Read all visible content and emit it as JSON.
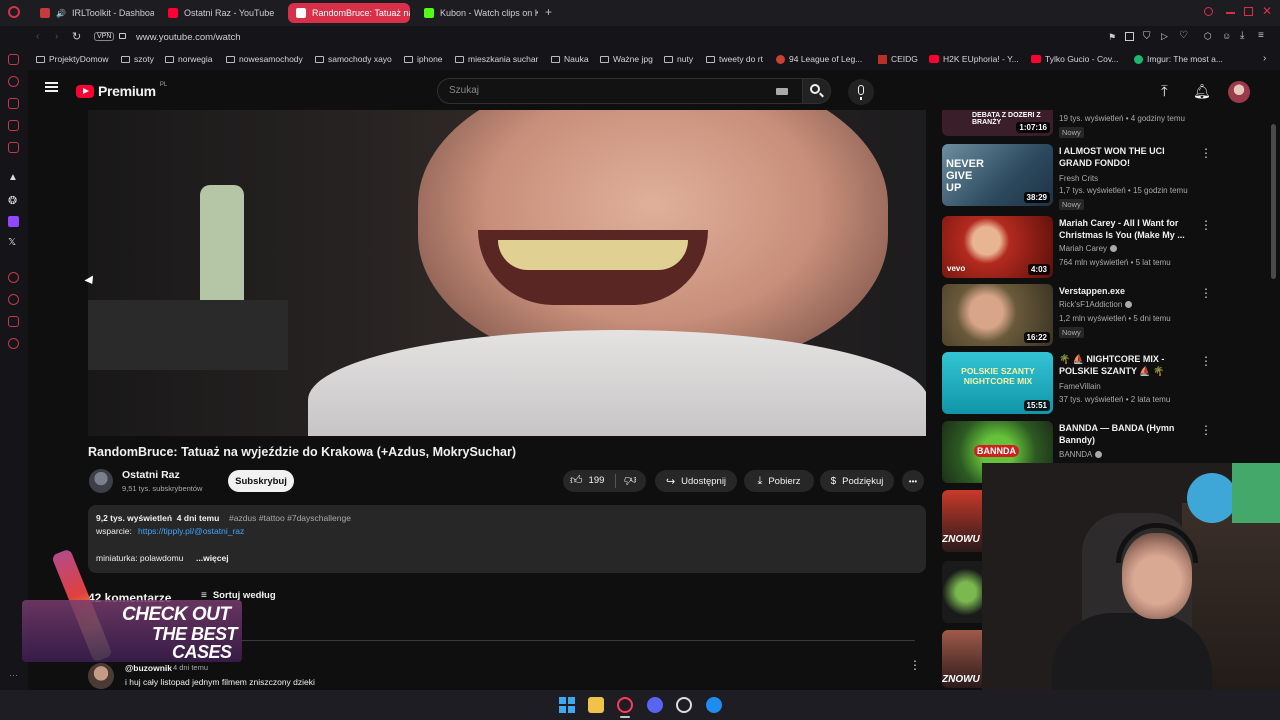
{
  "tabs": [
    {
      "label": "IRLToolkit - Dashboar",
      "color": "#c53a3a"
    },
    {
      "label": "Ostatni Raz - YouTube",
      "color": "#ff0033"
    },
    {
      "label": "RandomBruce: Tatuaż na",
      "color": "#ff0033"
    },
    {
      "label": "Kubon - Watch clips on K",
      "color": "#53fc18"
    }
  ],
  "new_tab": "+",
  "address": {
    "vpn": "VPN",
    "url": "www.youtube.com/watch"
  },
  "bookmarks": [
    "ProjektyDomow",
    "szoty",
    "norwegia",
    "nowesamochody",
    "samochody xayo",
    "iphone",
    "mieszkania suchar",
    "Nauka",
    "Ważne jpg",
    "nuty",
    "tweety do rt",
    "94 League of Leg...",
    "CEIDG",
    "H2K EUphoria! - Y...",
    "Tylko Gucio - Cov...",
    "Imgur: The most a..."
  ],
  "youtube": {
    "logo": "Premium",
    "logo_sup": "PL",
    "search_placeholder": "Szukaj"
  },
  "video": {
    "title": "RandomBruce: Tatuaż na wyjeździe do Krakowa (+Azdus, MokrySuchar)",
    "channel": "Ostatni Raz",
    "subscribers": "9,51 tys. subskrybentów",
    "subscribe_label": "Subskrybuj",
    "likes": "199",
    "share_label": "Udostępnij",
    "download_label": "Pobierz",
    "thanks_label": "Podziękuj",
    "more_label": "•••"
  },
  "description": {
    "views_date": "9,2 tys. wyświetleń  4 dni temu",
    "tags": "#azdus #tattoo #7dayschallenge",
    "support_label": "wsparcie:",
    "support_link": "https://tipply.pl/@ostatni_raz",
    "thumbnail_text": "miniaturka: polawdomu",
    "more": "...więcej"
  },
  "comments": {
    "count": "42 komentarze",
    "sort_label": "Sortuj według",
    "first_author": "@buzownik",
    "first_time": "4 dni temu",
    "first_text": "i huj cały listopad jednym filmem zniszczony dzieki"
  },
  "overlay_ad": {
    "line1": "CHECK OUT",
    "line2": "THE BEST",
    "line3": "CASES"
  },
  "recommendations": [
    {
      "thumb_text": "DEBATA Z DOZERI Z BRANŻY",
      "duration": "1:07:16",
      "title": "",
      "channel": "",
      "meta": "19 tys. wyświetleń • 4 godziny temu",
      "badge": "Nowy",
      "thumb_color": "#3a1f2b"
    },
    {
      "thumb_text": "NEVER GIVE UP",
      "duration": "38:29",
      "title": "I ALMOST WON THE UCI GRAND FONDO!",
      "channel": "Fresh Crits",
      "meta": "1,7 tys. wyświetleń • 15 godzin temu",
      "badge": "Nowy",
      "thumb_color": "#2d4a5e"
    },
    {
      "thumb_text": "vevo",
      "duration": "4:03",
      "title": "Mariah Carey - All I Want for Christmas Is You (Make My ...",
      "channel": "Mariah Carey",
      "meta": "764 mln wyświetleń • 5 lat temu",
      "badge": "",
      "thumb_color": "#7a1a14"
    },
    {
      "thumb_text": "",
      "duration": "16:22",
      "title": "Verstappen.exe",
      "channel": "Rick'sF1Addiction",
      "meta": "1,2 mln wyświetleń • 5 dni temu",
      "badge": "Nowy",
      "thumb_color": "#5a5040"
    },
    {
      "thumb_text": "POLSKIE SZANTY NIGHTCORE MIX",
      "duration": "15:51",
      "title": "🌴 ⛵ NIGHTCORE MIX - POLSKIE SZANTY ⛵ 🌴",
      "channel": "FameVillain",
      "meta": "37 tys. wyświetleń • 2 lata temu",
      "badge": "",
      "thumb_color": "#18a5b8"
    },
    {
      "thumb_text": "BANNDA",
      "duration": "",
      "title": "BANNDA — BANDA (Hymn Banndy)",
      "channel": "BANNDA",
      "meta": "",
      "badge": "",
      "thumb_color": "#3b7a2a"
    }
  ],
  "side_thumbs_text": [
    "ZNOWU",
    "ZNOWU"
  ],
  "colors": {
    "accent": "#ff0033",
    "browser_accent": "#d9304a",
    "link": "#3ea6ff"
  }
}
